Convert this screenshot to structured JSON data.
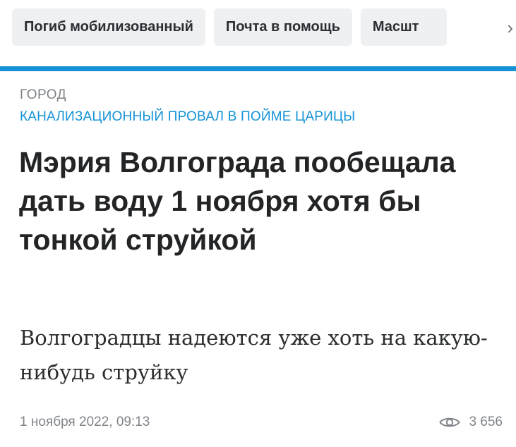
{
  "tags": [
    {
      "label": "Погиб мобилизованный"
    },
    {
      "label": "Почта в помощь"
    },
    {
      "label": "Масшт"
    }
  ],
  "icons": {
    "scroll": "chevron-right-icon",
    "views": "eye-icon"
  },
  "colors": {
    "accent": "#1592d6",
    "tag_bg": "#eef0f2",
    "muted": "#808489"
  },
  "article": {
    "rubric": "ГОРОД",
    "story": "КАНАЛИЗАЦИОННЫЙ ПРОВАЛ В ПОЙМЕ ЦАРИЦЫ",
    "headline": "Мэрия Волгограда пообещала дать воду 1 ноября хотя бы тонкой струйкой",
    "subtitle": "Волгоградцы надеются уже хоть на какую-нибудь струйку",
    "date": "1 ноября 2022, 09:13",
    "views": "3 656"
  }
}
